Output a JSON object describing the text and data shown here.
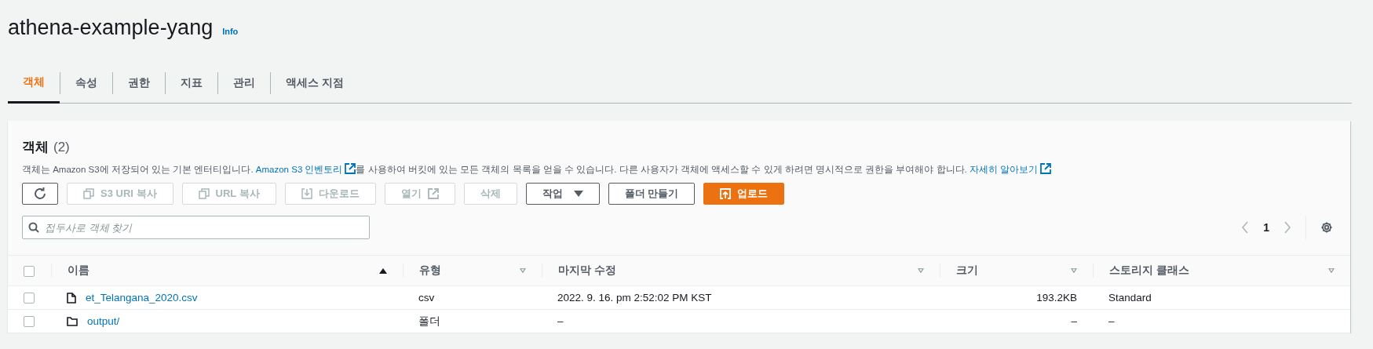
{
  "header": {
    "title": "athena-example-yang",
    "info_link": "Info"
  },
  "tabs": [
    {
      "label": "객체",
      "selected": true
    },
    {
      "label": "속성",
      "selected": false
    },
    {
      "label": "권한",
      "selected": false
    },
    {
      "label": "지표",
      "selected": false
    },
    {
      "label": "관리",
      "selected": false
    },
    {
      "label": "액세스 지점",
      "selected": false
    }
  ],
  "objects": {
    "heading": "객체",
    "count": "(2)",
    "description": [
      {
        "kind": "text",
        "text": "객체는 Amazon S3에 저장되어 있는 기본 엔터티입니다. "
      },
      {
        "kind": "extlink",
        "text": "Amazon S3 인벤토리"
      },
      {
        "kind": "text",
        "text": "를 사용하여 버킷에 있는 모든 객체의 목록을 얻을 수 있습니다. 다른 사용자가 객체에 액세스할 수 있게 하려면 명시적으로 권한을 부여해야 합니다. "
      },
      {
        "kind": "extlink",
        "text": "자세히 알아보기"
      }
    ],
    "buttons": [
      {
        "kind": "refresh",
        "disabled": false
      },
      {
        "kind": "copy",
        "label": "S3 URI 복사",
        "disabled": true
      },
      {
        "kind": "copy",
        "label": "URL 복사",
        "disabled": true
      },
      {
        "kind": "download",
        "label": "다운로드",
        "disabled": true
      },
      {
        "kind": "open",
        "label": "열기",
        "disabled": true
      },
      {
        "kind": "plain",
        "label": "삭제",
        "disabled": true
      },
      {
        "kind": "dropdown",
        "label": "작업",
        "disabled": false
      },
      {
        "kind": "plain",
        "label": "폴더 만들기",
        "disabled": false
      },
      {
        "kind": "upload",
        "label": "업로드",
        "disabled": false
      }
    ],
    "search": {
      "placeholder": "접두사로 객체 찾기"
    },
    "pagination": {
      "page": "1"
    },
    "select_all": {
      "checked": false
    },
    "columns": [
      {
        "label": "이름",
        "sorted": true
      },
      {
        "label": "유형",
        "sorted": false
      },
      {
        "label": "마지막 수정",
        "sorted": false
      },
      {
        "label": "크기",
        "sorted": false
      },
      {
        "label": "스토리지 클래스",
        "sorted": false
      }
    ],
    "rows": [
      {
        "kind": "file",
        "checked": false,
        "name": "et_Telangana_2020.csv",
        "type": "csv",
        "modified": "2022. 9. 16. pm 2:52:02 PM KST",
        "size": "193.2KB",
        "storage_class": "Standard"
      },
      {
        "kind": "folder",
        "checked": false,
        "name": "output/",
        "type": "폴더",
        "modified": "–",
        "size": "–",
        "storage_class": "–"
      }
    ]
  }
}
